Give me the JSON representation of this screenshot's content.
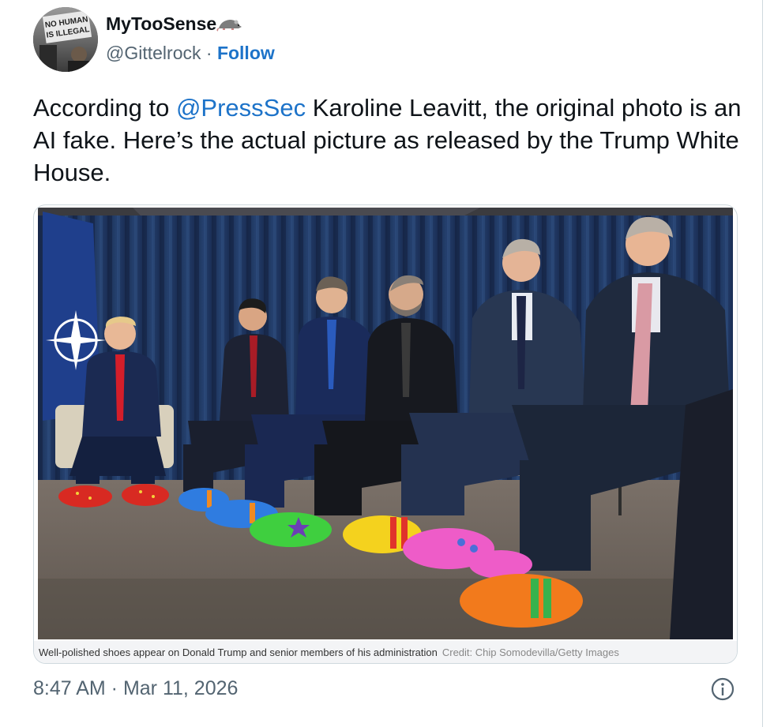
{
  "user": {
    "display_name": "MyTooSense",
    "name_emoji": "rat-icon",
    "handle": "@Gittelrock",
    "separator": " · ",
    "follow_label": "Follow",
    "avatar_sign_text": "NO HUMAN IS ILLEGAL"
  },
  "tweet": {
    "text_before_mention": "According to ",
    "mention": "@PressSec",
    "text_after_mention": " Karoline Leavitt, the original photo is an AI fake. Here’s the actual picture as released by the Trump White House."
  },
  "media": {
    "caption": "Well-polished shoes appear on Donald Trump and senior members of his administration",
    "credit": "Credit: Chip Somodevilla/Getty Images"
  },
  "meta": {
    "timestamp": "8:47 AM · Mar 11, 2026",
    "info_icon": "info-icon"
  },
  "colors": {
    "link_blue": "#1d73c9",
    "text_primary": "#0f1419",
    "text_secondary": "#536471",
    "curtain_navy": "#1c2f54"
  }
}
